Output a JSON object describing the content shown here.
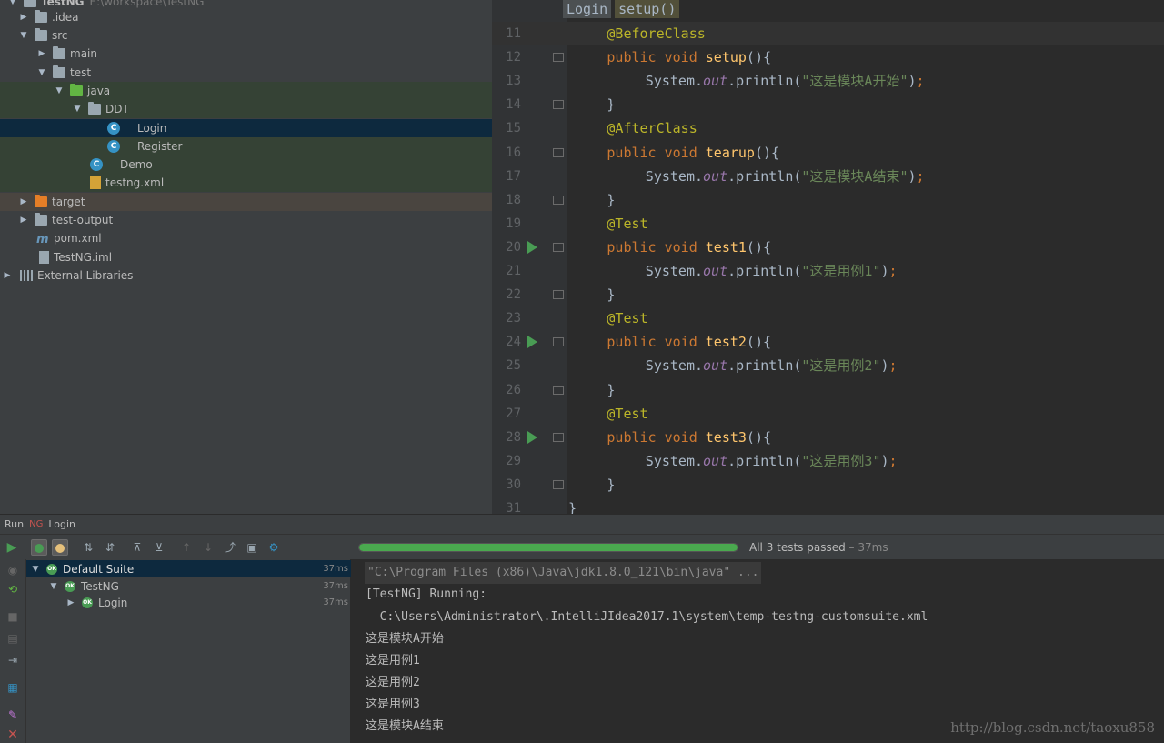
{
  "project_tree": {
    "root_label": "TestNG",
    "root_path": "E:\\workspace\\TestNG",
    "items": [
      {
        "label": "idea",
        "prefix": ".",
        "icon": "folder-icon"
      },
      {
        "label": "src",
        "icon": "folder-icon"
      },
      {
        "label": "main",
        "icon": "folder-icon"
      },
      {
        "label": "test",
        "icon": "folder-icon"
      },
      {
        "label": "java",
        "icon": "test-source-folder-icon"
      },
      {
        "label": "DDT",
        "icon": "package-icon"
      },
      {
        "label": "Login",
        "icon": "test-class-icon"
      },
      {
        "label": "Register",
        "icon": "test-class-icon"
      },
      {
        "label": "Demo",
        "icon": "test-class-icon"
      },
      {
        "label": "testng.xml",
        "icon": "xml-file-icon"
      },
      {
        "label": "target",
        "icon": "excluded-folder-icon"
      },
      {
        "label": "test-output",
        "icon": "folder-icon"
      },
      {
        "label": "pom.xml",
        "icon": "maven-icon"
      },
      {
        "label": "TestNG.iml",
        "icon": "module-file-icon"
      },
      {
        "label": "External Libraries",
        "icon": "libraries-icon"
      }
    ]
  },
  "editor": {
    "breadcrumbs": [
      "Login",
      "setup()"
    ],
    "lines": [
      {
        "n": "11",
        "indent": "    ",
        "text": "@BeforeClass"
      },
      {
        "n": "12",
        "indent": "    ",
        "text": "public void setup(){"
      },
      {
        "n": "13",
        "indent": "        ",
        "text": "System.out.println(\"这是模块A开始\");"
      },
      {
        "n": "14",
        "indent": "    ",
        "text": "}"
      },
      {
        "n": "15",
        "indent": "    ",
        "text": "@AfterClass"
      },
      {
        "n": "16",
        "indent": "    ",
        "text": "public void tearup(){"
      },
      {
        "n": "17",
        "indent": "        ",
        "text": "System.out.println(\"这是模块A结束\");"
      },
      {
        "n": "18",
        "indent": "    ",
        "text": "}"
      },
      {
        "n": "19",
        "indent": "    ",
        "text": "@Test"
      },
      {
        "n": "20",
        "indent": "    ",
        "text": "public void test1(){"
      },
      {
        "n": "21",
        "indent": "        ",
        "text": "System.out.println(\"这是用例1\");"
      },
      {
        "n": "22",
        "indent": "    ",
        "text": "}"
      },
      {
        "n": "23",
        "indent": "    ",
        "text": "@Test"
      },
      {
        "n": "24",
        "indent": "    ",
        "text": "public void test2(){"
      },
      {
        "n": "25",
        "indent": "        ",
        "text": "System.out.println(\"这是用例2\");"
      },
      {
        "n": "26",
        "indent": "    ",
        "text": "}"
      },
      {
        "n": "27",
        "indent": "    ",
        "text": "@Test"
      },
      {
        "n": "28",
        "indent": "    ",
        "text": "public void test3(){"
      },
      {
        "n": "29",
        "indent": "        ",
        "text": "System.out.println(\"这是用例3\");"
      },
      {
        "n": "30",
        "indent": "    ",
        "text": "}"
      },
      {
        "n": "31",
        "indent": "",
        "text": "}"
      }
    ]
  },
  "run_panel": {
    "title_prefix": "Run",
    "config_name": "Login",
    "status": "All 3 tests passed",
    "status_time": " – 37ms",
    "progress": 1.0,
    "tests": [
      {
        "label": "Default Suite",
        "time": "37ms"
      },
      {
        "label": "TestNG",
        "time": "37ms"
      },
      {
        "label": "Login",
        "time": "37ms"
      }
    ],
    "console": [
      "\"C:\\Program Files (x86)\\Java\\jdk1.8.0_121\\bin\\java\" ...",
      "[TestNG] Running:",
      "  C:\\Users\\Administrator\\.IntelliJIdea2017.1\\system\\temp-testng-customsuite.xml",
      "这是模块A开始",
      "这是用例1",
      "这是用例2",
      "这是用例3",
      "这是模块A结束"
    ]
  },
  "watermark": "http://blog.csdn.net/taoxu858",
  "colors": {
    "keyword": "#cc7832",
    "annotation": "#bbb529",
    "string": "#6a8759",
    "function": "#ffc66d",
    "progress": "#4aa94f"
  }
}
